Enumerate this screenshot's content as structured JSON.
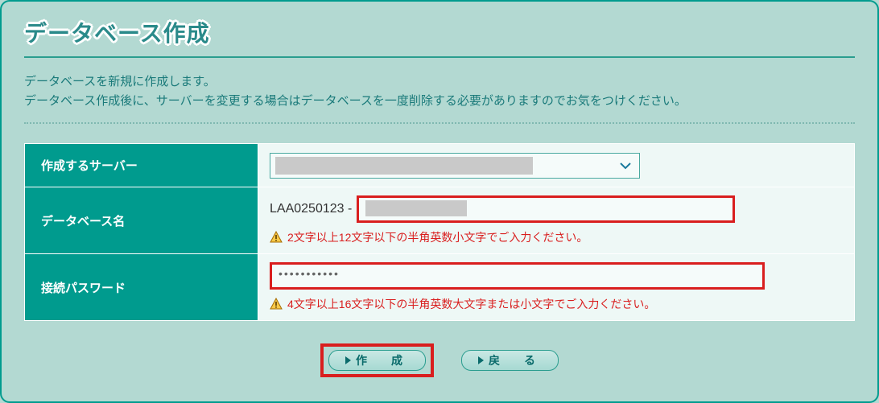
{
  "header": {
    "title": "データベース作成"
  },
  "intro": {
    "line1": "データベースを新規に作成します。",
    "line2": "データベース作成後に、サーバーを変更する場合はデータベースを一度削除する必要がありますのでお気をつけください。"
  },
  "form": {
    "server": {
      "label": "作成するサーバー",
      "selected": ""
    },
    "dbname": {
      "label": "データベース名",
      "prefix": "LAA0250123 -",
      "value": "",
      "hint": "2文字以上12文字以下の半角英数小文字でご入力ください。"
    },
    "password": {
      "label": "接続パスワード",
      "value": "•••••••••••",
      "hint": "4文字以上16文字以下の半角英数大文字または小文字でご入力ください。"
    }
  },
  "buttons": {
    "create": "作　成",
    "back": "戻　る"
  }
}
